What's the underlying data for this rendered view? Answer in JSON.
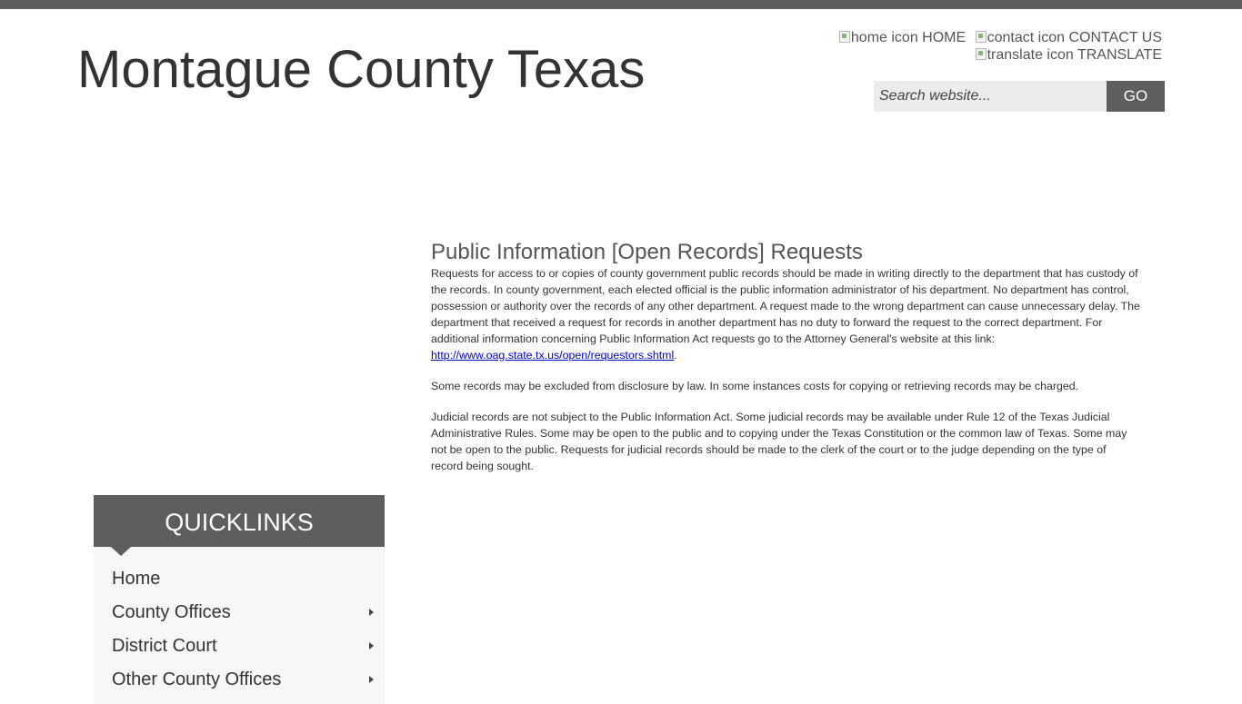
{
  "site": {
    "title": "Montague County Texas"
  },
  "header": {
    "links": [
      {
        "icon_alt": "home icon",
        "label": "HOME",
        "icon": "home-icon"
      },
      {
        "icon_alt": "contact icon",
        "label": "CONTACT US",
        "icon": "contact-icon"
      },
      {
        "icon_alt": "translate icon",
        "label": "TRANSLATE",
        "icon": "translate-icon"
      }
    ],
    "search": {
      "placeholder": "Search website...",
      "button_label": "GO"
    }
  },
  "main": {
    "heading": "Public Information [Open Records] Requests",
    "paragraph1": "Requests for access to or copies of county government public records should be made in writing directly to the department that has custody of the records. In county government, each elected official is the public information administrator of his department. No department has control, possession or authority over the records of any other department. A request made to the wrong department can cause unnecessary delay. The department that received a request for records in another department has no duty to forward the request to the correct department.   For additional information concerning Public Information Act requests go to the Attorney General's website at this link: ",
    "link": "http://www.oag.state.tx.us/open/requestors.shtml",
    "link_suffix": ".",
    "paragraph2": "Some records may be excluded from disclosure by law. In some instances costs for copying or retrieving records may be charged.",
    "paragraph3": "Judicial records are not subject to the Public Information Act. Some judicial records may be available under Rule 12 of the Texas Judicial Administrative Rules. Some may be open to the public and to copying under the Texas Constitution or the common law of Texas. Some may not be open to the public. Requests for judicial records should be made to the clerk of the court or to the judge depending on the type of record being sought."
  },
  "quicklinks": {
    "title": "QUICKLINKS",
    "items": [
      {
        "label": "Home",
        "has_submenu": false
      },
      {
        "label": "County Offices",
        "has_submenu": true
      },
      {
        "label": "District Court",
        "has_submenu": true
      },
      {
        "label": "Other County Offices",
        "has_submenu": true
      }
    ]
  },
  "colors": {
    "bar": "#5e5e5e",
    "link": "#0000cc",
    "heading": "#555555"
  }
}
